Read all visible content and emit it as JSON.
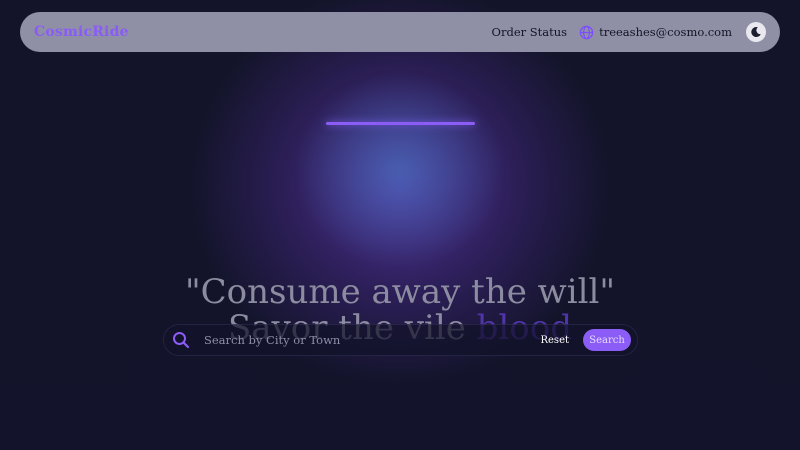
{
  "navbar": {
    "brand": "CosmicRide",
    "order_status": "Order Status",
    "user_email": "treeashes@cosmo.com",
    "user_icon": "globe-icon",
    "theme_icon": "moon-icon"
  },
  "hero": {
    "quote_line1": "\"Consume away the will\"",
    "quote_line2_prefix": "Savor the vile ",
    "quote_line2_accent": "blood"
  },
  "search": {
    "icon": "search-icon",
    "placeholder": "Search by City or Town",
    "reset_label": "Reset",
    "search_label": "Search"
  },
  "colors": {
    "accent": "#8b5cf6",
    "background": "#13142b",
    "navbar": "#8f8fa6"
  }
}
